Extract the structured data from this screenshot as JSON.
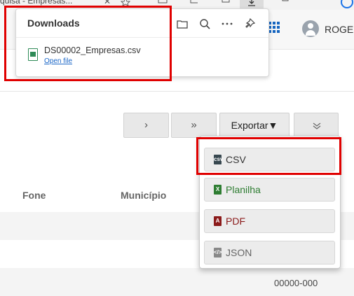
{
  "browser": {
    "tab_title": "quisa - Empresas..."
  },
  "user": {
    "name": "ROGER"
  },
  "downloads": {
    "title": "Downloads",
    "file_name": "DS00002_Empresas.csv",
    "open_label": "Open file"
  },
  "pager": {
    "next": "›",
    "last": "»",
    "collapse": "˅"
  },
  "export": {
    "label": "Exportar▼",
    "options": [
      {
        "label": "CSV",
        "color": "#333333",
        "icon_color": "#37474f"
      },
      {
        "label": "Planilha",
        "color": "#2e7d32",
        "icon_color": "#2e7d32"
      },
      {
        "label": "PDF",
        "color": "#8b1a1a",
        "icon_color": "#8b1a1a"
      },
      {
        "label": "JSON",
        "color": "#666666",
        "icon_color": "#888888"
      }
    ]
  },
  "table": {
    "columns": [
      "Fone",
      "Município"
    ],
    "visible_cell": "00000-000"
  },
  "colors": {
    "highlight": "#e00000",
    "link": "#1a66c7",
    "app_icon": "#1565c0"
  }
}
